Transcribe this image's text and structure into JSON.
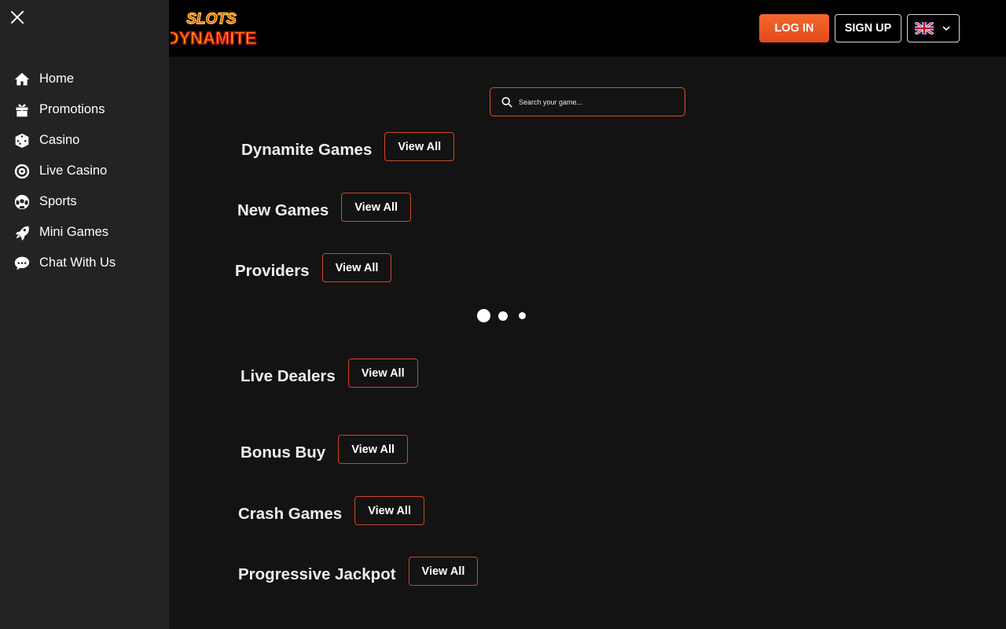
{
  "sidebar": {
    "items": [
      {
        "label": "Home",
        "icon": "home-icon"
      },
      {
        "label": "Promotions",
        "icon": "gift-icon"
      },
      {
        "label": "Casino",
        "icon": "dice-icon"
      },
      {
        "label": "Live Casino",
        "icon": "roulette-icon"
      },
      {
        "label": "Sports",
        "icon": "soccer-ball-icon"
      },
      {
        "label": "Mini Games",
        "icon": "rocket-icon"
      },
      {
        "label": "Chat With Us",
        "icon": "chat-icon"
      }
    ]
  },
  "header": {
    "logo_line1": "SLOTS",
    "logo_line2": "DYNAMITE",
    "login_label": "LOG IN",
    "signup_label": "SIGN UP",
    "language_flag": "uk-flag-icon"
  },
  "search": {
    "placeholder": "Search your game..."
  },
  "sections": [
    {
      "title": "Dynamite Games",
      "button": "View All"
    },
    {
      "title": "New Games",
      "button": "View All"
    },
    {
      "title": "Providers",
      "button": "View All"
    },
    {
      "title": "Live Dealers",
      "button": "View All"
    },
    {
      "title": "Bonus Buy",
      "button": "View All"
    },
    {
      "title": "Crash Games",
      "button": "View All"
    },
    {
      "title": "Progressive Jackpot",
      "button": "View All"
    }
  ],
  "colors": {
    "accent": "#e4491c",
    "border_accent": "#d2452a",
    "background": "#131313",
    "sidebar": "#232323",
    "header": "#000000"
  }
}
